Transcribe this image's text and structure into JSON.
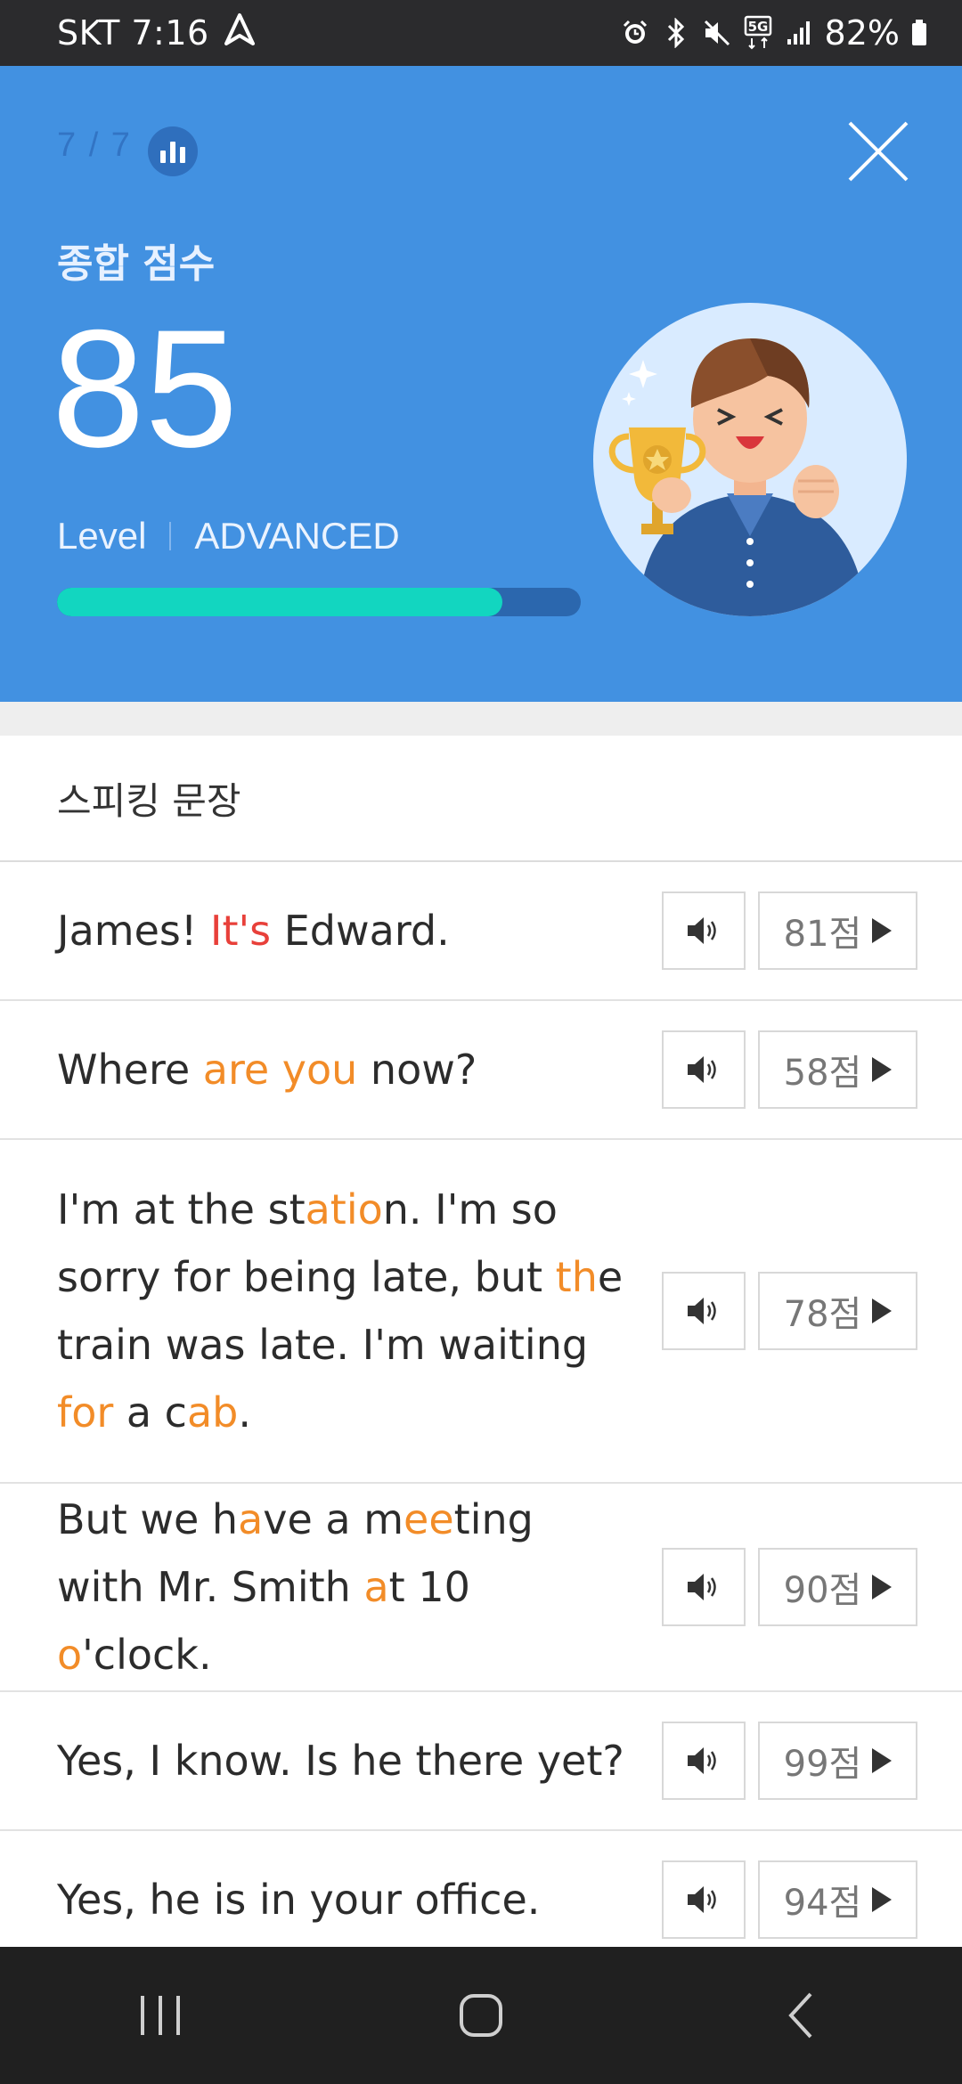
{
  "status_bar": {
    "carrier_time": "SKT 7:16",
    "network": "5G",
    "battery": "82%"
  },
  "header": {
    "progress": "7 / 7",
    "score_label": "종합 점수",
    "score": "85",
    "level_label": "Level",
    "level_value": "ADVANCED",
    "score_fraction": 0.85,
    "accent_color": "#4291e1",
    "bar_color": "#12d6c0"
  },
  "section": {
    "title": "스피킹 문장"
  },
  "sentences": [
    {
      "segments": [
        {
          "t": "James! ",
          "c": ""
        },
        {
          "t": "It's",
          "c": "red"
        },
        {
          "t": " Edward.",
          "c": ""
        }
      ],
      "score": "81점"
    },
    {
      "segments": [
        {
          "t": "Where ",
          "c": ""
        },
        {
          "t": "are you",
          "c": "orange"
        },
        {
          "t": " now?",
          "c": ""
        }
      ],
      "score": "58점"
    },
    {
      "segments": [
        {
          "t": "I'm at the st",
          "c": ""
        },
        {
          "t": "atio",
          "c": "orange"
        },
        {
          "t": "n. I'm so sorry for being late, but ",
          "c": ""
        },
        {
          "t": "th",
          "c": "orange"
        },
        {
          "t": "e train was late. I'm waiting ",
          "c": ""
        },
        {
          "t": "for",
          "c": "orange"
        },
        {
          "t": " a c",
          "c": ""
        },
        {
          "t": "ab",
          "c": "orange"
        },
        {
          "t": ".",
          "c": ""
        }
      ],
      "score": "78점"
    },
    {
      "segments": [
        {
          "t": "But we h",
          "c": ""
        },
        {
          "t": "a",
          "c": "orange"
        },
        {
          "t": "ve a m",
          "c": ""
        },
        {
          "t": "ee",
          "c": "orange"
        },
        {
          "t": "ting with Mr. Smith ",
          "c": ""
        },
        {
          "t": "a",
          "c": "orange"
        },
        {
          "t": "t 10 ",
          "c": ""
        },
        {
          "t": "o",
          "c": "orange"
        },
        {
          "t": "'clock.",
          "c": ""
        }
      ],
      "score": "90점"
    },
    {
      "segments": [
        {
          "t": "Yes, I know. Is he there yet?",
          "c": ""
        }
      ],
      "score": "99점"
    },
    {
      "segments": [
        {
          "t": "Yes, he is in your office.",
          "c": ""
        }
      ],
      "score": "94점"
    }
  ],
  "icons": {
    "stats": "bar-chart-icon",
    "close": "close-icon",
    "audio": "speaker-icon",
    "play": "play-icon"
  }
}
